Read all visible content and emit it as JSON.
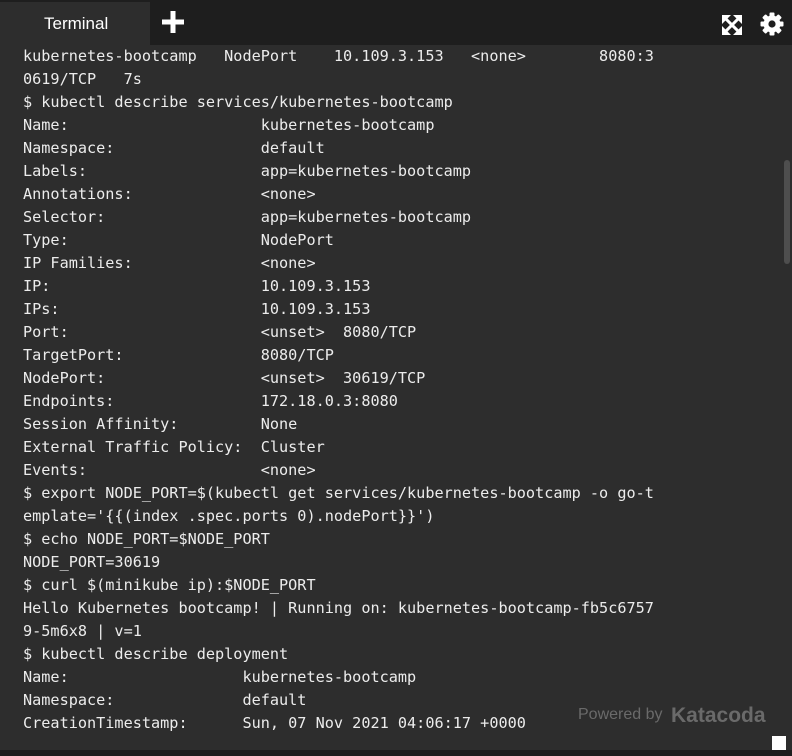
{
  "tabs": [
    {
      "label": "Terminal",
      "active": true
    }
  ],
  "toolbar": {
    "add_tab_icon": "plus-icon",
    "expand_icon": "expand-icon",
    "settings_icon": "gear-icon"
  },
  "terminal": {
    "lines": [
      "kubernetes-bootcamp   NodePort    10.109.3.153   <none>        8080:3",
      "0619/TCP   7s",
      "$ kubectl describe services/kubernetes-bootcamp",
      "Name:                     kubernetes-bootcamp",
      "Namespace:                default",
      "Labels:                   app=kubernetes-bootcamp",
      "Annotations:              <none>",
      "Selector:                 app=kubernetes-bootcamp",
      "Type:                     NodePort",
      "IP Families:              <none>",
      "IP:                       10.109.3.153",
      "IPs:                      10.109.3.153",
      "Port:                     <unset>  8080/TCP",
      "TargetPort:               8080/TCP",
      "NodePort:                 <unset>  30619/TCP",
      "Endpoints:                172.18.0.3:8080",
      "Session Affinity:         None",
      "External Traffic Policy:  Cluster",
      "Events:                   <none>",
      "$ export NODE_PORT=$(kubectl get services/kubernetes-bootcamp -o go-t",
      "emplate='{{(index .spec.ports 0).nodePort}}')",
      "$ echo NODE_PORT=$NODE_PORT",
      "NODE_PORT=30619",
      "$ curl $(minikube ip):$NODE_PORT",
      "Hello Kubernetes bootcamp! | Running on: kubernetes-bootcamp-fb5c6757",
      "9-5m6x8 | v=1",
      "$ kubectl describe deployment",
      "Name:                   kubernetes-bootcamp",
      "Namespace:              default",
      "CreationTimestamp:      Sun, 07 Nov 2021 04:06:17 +0000"
    ]
  },
  "watermark": {
    "prefix": "Powered by",
    "brand": "Katacoda"
  },
  "colors": {
    "terminal_background": "#2d2d2d",
    "chrome_background": "#1e1e1e",
    "text": "#ececec"
  }
}
